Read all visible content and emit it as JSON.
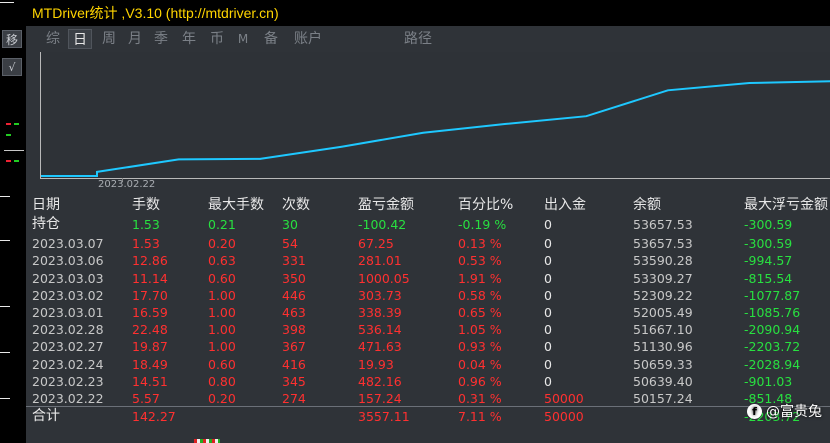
{
  "window": {
    "title": "MTDriver统计 ,V3.10 (http://mtdriver.cn)"
  },
  "left_tools": [
    {
      "name": "move",
      "label": "移"
    },
    {
      "name": "check",
      "label": "√"
    }
  ],
  "tabs": [
    {
      "label": "综",
      "active": false
    },
    {
      "label": "日",
      "active": true
    },
    {
      "label": "周",
      "active": false
    },
    {
      "label": "月",
      "active": false
    },
    {
      "label": "季",
      "active": false
    },
    {
      "label": "年",
      "active": false
    },
    {
      "label": "币",
      "active": false
    },
    {
      "label": "M",
      "active": false
    },
    {
      "label": "备",
      "active": false
    },
    {
      "label": "账户",
      "active": false
    },
    {
      "label": "路径",
      "active": false
    }
  ],
  "chart_data": {
    "type": "line",
    "xlabel": "",
    "ylabel": "",
    "x_tick_labels": [
      "2023.02.22"
    ],
    "x": [
      "2023.02.22",
      "2023.02.23",
      "2023.02.24",
      "2023.02.27",
      "2023.02.28",
      "2023.03.01",
      "2023.03.02",
      "2023.03.03",
      "2023.03.06",
      "2023.03.07"
    ],
    "series": [
      {
        "values": [
          157.24,
          639.4,
          659.33,
          1130.96,
          1667.1,
          2005.49,
          2309.22,
          3309.27,
          3590.28,
          3657.53
        ]
      }
    ],
    "grid": false,
    "color": "#1ec8ff"
  },
  "table": {
    "columns": [
      "日期",
      "手数",
      "最大手数",
      "次数",
      "盈亏金额",
      "百分比%",
      "出入金",
      "余额",
      "最大浮亏金额"
    ],
    "holding": {
      "label": "持仓",
      "lots": "1.53",
      "max_lots": "0.21",
      "count": "30",
      "pnl": "-100.42",
      "pct": "-0.19 %",
      "flow": "0",
      "balance": "53657.53",
      "max_float_loss": "-300.59"
    },
    "rows": [
      {
        "date": "2023.03.07",
        "lots": "1.53",
        "max_lots": "0.20",
        "count": "54",
        "pnl": "67.25",
        "pct": "0.13 %",
        "flow": "0",
        "balance": "53657.53",
        "max_float_loss": "-300.59"
      },
      {
        "date": "2023.03.06",
        "lots": "12.86",
        "max_lots": "0.63",
        "count": "331",
        "pnl": "281.01",
        "pct": "0.53 %",
        "flow": "0",
        "balance": "53590.28",
        "max_float_loss": "-994.57"
      },
      {
        "date": "2023.03.03",
        "lots": "11.14",
        "max_lots": "0.60",
        "count": "350",
        "pnl": "1000.05",
        "pct": "1.91 %",
        "flow": "0",
        "balance": "53309.27",
        "max_float_loss": "-815.54"
      },
      {
        "date": "2023.03.02",
        "lots": "17.70",
        "max_lots": "1.00",
        "count": "446",
        "pnl": "303.73",
        "pct": "0.58 %",
        "flow": "0",
        "balance": "52309.22",
        "max_float_loss": "-1077.87"
      },
      {
        "date": "2023.03.01",
        "lots": "16.59",
        "max_lots": "1.00",
        "count": "463",
        "pnl": "338.39",
        "pct": "0.65 %",
        "flow": "0",
        "balance": "52005.49",
        "max_float_loss": "-1085.76"
      },
      {
        "date": "2023.02.28",
        "lots": "22.48",
        "max_lots": "1.00",
        "count": "398",
        "pnl": "536.14",
        "pct": "1.05 %",
        "flow": "0",
        "balance": "51667.10",
        "max_float_loss": "-2090.94"
      },
      {
        "date": "2023.02.27",
        "lots": "19.87",
        "max_lots": "1.00",
        "count": "367",
        "pnl": "471.63",
        "pct": "0.93 %",
        "flow": "0",
        "balance": "51130.96",
        "max_float_loss": "-2203.72"
      },
      {
        "date": "2023.02.24",
        "lots": "18.49",
        "max_lots": "0.60",
        "count": "416",
        "pnl": "19.93",
        "pct": "0.04 %",
        "flow": "0",
        "balance": "50659.33",
        "max_float_loss": "-2028.94"
      },
      {
        "date": "2023.02.23",
        "lots": "14.51",
        "max_lots": "0.80",
        "count": "345",
        "pnl": "482.16",
        "pct": "0.96 %",
        "flow": "0",
        "balance": "50639.40",
        "max_float_loss": "-901.03"
      },
      {
        "date": "2023.02.22",
        "lots": "5.57",
        "max_lots": "0.20",
        "count": "274",
        "pnl": "157.24",
        "pct": "0.31 %",
        "flow": "50000",
        "balance": "50157.24",
        "max_float_loss": "-851.48"
      }
    ],
    "total": {
      "label": "合计",
      "lots": "142.27",
      "pnl": "3557.11",
      "pct": "7.11 %",
      "flow": "50000",
      "max_float_loss": "-2203.72"
    }
  },
  "watermark": {
    "icon": "f",
    "text": "@富贵兔"
  }
}
